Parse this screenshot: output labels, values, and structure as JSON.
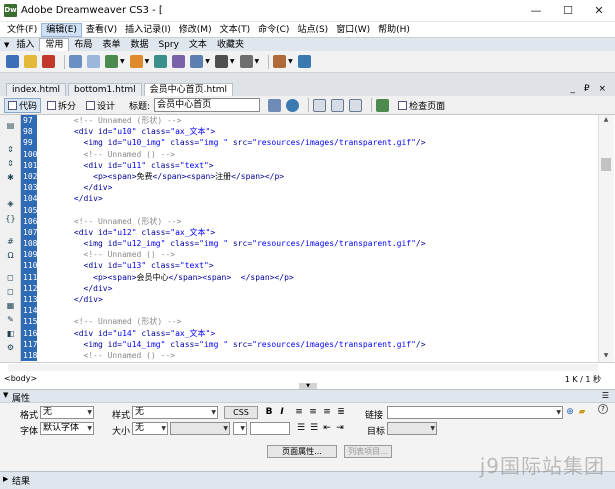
{
  "window": {
    "title": "Adobe Dreamweaver CS3 - [",
    "minimize": "—",
    "maximize": "☐",
    "close": "✕"
  },
  "menubar": [
    "文件(F)",
    "编辑(E)",
    "查看(V)",
    "插入记录(I)",
    "修改(M)",
    "文本(T)",
    "命令(C)",
    "站点(S)",
    "窗口(W)",
    "帮助(H)"
  ],
  "insertbar": {
    "label": "插入",
    "tabs": [
      "常用",
      "布局",
      "表单",
      "数据",
      "Spry",
      "文本",
      "收藏夹"
    ]
  },
  "document_tabs": [
    "index.html",
    "bottom1.html",
    "会员中心首页.html"
  ],
  "doc_controls": "_ ₽ ×",
  "doc_toolbar": {
    "code": "代码",
    "split": "拆分",
    "design": "设计",
    "title_label": "标题:",
    "title_value": "会员中心首页",
    "check_page": "检查页面"
  },
  "code_lines": [
    {
      "n": "97",
      "segs": [
        {
          "c": "cmt",
          "t": "      <!-- Unnamed (形状) -->"
        }
      ]
    },
    {
      "n": "98",
      "segs": [
        {
          "c": "tag",
          "t": "      <div id="
        },
        {
          "c": "val",
          "t": "\"u10\""
        },
        {
          "c": "tag",
          "t": " class="
        },
        {
          "c": "val",
          "t": "\"ax_文本\""
        },
        {
          "c": "tag",
          "t": ">"
        }
      ]
    },
    {
      "n": "99",
      "segs": [
        {
          "c": "tag",
          "t": "        <img id="
        },
        {
          "c": "val",
          "t": "\"u10_img\""
        },
        {
          "c": "tag",
          "t": " class="
        },
        {
          "c": "val",
          "t": "\"img \""
        },
        {
          "c": "tag",
          "t": " src="
        },
        {
          "c": "val",
          "t": "\"resources/images/transparent.gif\""
        },
        {
          "c": "tag",
          "t": "/>"
        }
      ]
    },
    {
      "n": "100",
      "segs": [
        {
          "c": "cmt",
          "t": "        <!-- Unnamed () -->"
        }
      ]
    },
    {
      "n": "101",
      "segs": [
        {
          "c": "tag",
          "t": "        <div id="
        },
        {
          "c": "val",
          "t": "\"u11\""
        },
        {
          "c": "tag",
          "t": " class="
        },
        {
          "c": "val",
          "t": "\"text\""
        },
        {
          "c": "tag",
          "t": ">"
        }
      ]
    },
    {
      "n": "102",
      "segs": [
        {
          "c": "tag",
          "t": "          <p><span>"
        },
        {
          "c": "txt",
          "t": "免费"
        },
        {
          "c": "tag",
          "t": "</span><span>"
        },
        {
          "c": "txt",
          "t": "注册"
        },
        {
          "c": "tag",
          "t": "</span></p>"
        }
      ]
    },
    {
      "n": "103",
      "segs": [
        {
          "c": "tag",
          "t": "        </div>"
        }
      ]
    },
    {
      "n": "104",
      "segs": [
        {
          "c": "tag",
          "t": "      </div>"
        }
      ]
    },
    {
      "n": "105",
      "segs": [
        {
          "c": "txt",
          "t": ""
        }
      ]
    },
    {
      "n": "106",
      "segs": [
        {
          "c": "cmt",
          "t": "      <!-- Unnamed (形状) -->"
        }
      ]
    },
    {
      "n": "107",
      "segs": [
        {
          "c": "tag",
          "t": "      <div id="
        },
        {
          "c": "val",
          "t": "\"u12\""
        },
        {
          "c": "tag",
          "t": " class="
        },
        {
          "c": "val",
          "t": "\"ax_文本\""
        },
        {
          "c": "tag",
          "t": ">"
        }
      ]
    },
    {
      "n": "108",
      "segs": [
        {
          "c": "tag",
          "t": "        <img id="
        },
        {
          "c": "val",
          "t": "\"u12_img\""
        },
        {
          "c": "tag",
          "t": " class="
        },
        {
          "c": "val",
          "t": "\"img \""
        },
        {
          "c": "tag",
          "t": " src="
        },
        {
          "c": "val",
          "t": "\"resources/images/transparent.gif\""
        },
        {
          "c": "tag",
          "t": "/>"
        }
      ]
    },
    {
      "n": "109",
      "segs": [
        {
          "c": "cmt",
          "t": "        <!-- Unnamed () -->"
        }
      ]
    },
    {
      "n": "110",
      "segs": [
        {
          "c": "tag",
          "t": "        <div id="
        },
        {
          "c": "val",
          "t": "\"u13\""
        },
        {
          "c": "tag",
          "t": " class="
        },
        {
          "c": "val",
          "t": "\"text\""
        },
        {
          "c": "tag",
          "t": ">"
        }
      ]
    },
    {
      "n": "111",
      "segs": [
        {
          "c": "tag",
          "t": "          <p><span>"
        },
        {
          "c": "txt",
          "t": "会员中心"
        },
        {
          "c": "tag",
          "t": "</span><span>  </span></p>"
        }
      ]
    },
    {
      "n": "112",
      "segs": [
        {
          "c": "tag",
          "t": "        </div>"
        }
      ]
    },
    {
      "n": "113",
      "segs": [
        {
          "c": "tag",
          "t": "      </div>"
        }
      ]
    },
    {
      "n": "114",
      "segs": [
        {
          "c": "txt",
          "t": ""
        }
      ]
    },
    {
      "n": "115",
      "segs": [
        {
          "c": "cmt",
          "t": "      <!-- Unnamed (形状) -->"
        }
      ]
    },
    {
      "n": "116",
      "segs": [
        {
          "c": "tag",
          "t": "      <div id="
        },
        {
          "c": "val",
          "t": "\"u14\""
        },
        {
          "c": "tag",
          "t": " class="
        },
        {
          "c": "val",
          "t": "\"ax_文本\""
        },
        {
          "c": "tag",
          "t": ">"
        }
      ]
    },
    {
      "n": "117",
      "segs": [
        {
          "c": "tag",
          "t": "        <img id="
        },
        {
          "c": "val",
          "t": "\"u14_img\""
        },
        {
          "c": "tag",
          "t": " class="
        },
        {
          "c": "val",
          "t": "\"img \""
        },
        {
          "c": "tag",
          "t": " src="
        },
        {
          "c": "val",
          "t": "\"resources/images/transparent.gif\""
        },
        {
          "c": "tag",
          "t": "/>"
        }
      ]
    },
    {
      "n": "118",
      "segs": [
        {
          "c": "cmt",
          "t": "        <!-- Unnamed () -->"
        }
      ]
    }
  ],
  "status": {
    "tag": "<body>",
    "right": "1 K / 1 秒"
  },
  "properties": {
    "title": "属性",
    "format_label": "格式",
    "format_value": "无",
    "style_label": "样式",
    "style_value": "无",
    "css_button": "CSS",
    "link_label": "链接",
    "font_label": "字体",
    "font_value": "默认字体",
    "size_label": "大小",
    "size_value": "无",
    "target_label": "目标",
    "page_props_button": "页面属性...",
    "list_item_button": "列表项目..."
  },
  "results": {
    "title": "结果"
  },
  "watermark": "j9国际站集团",
  "colors": {
    "line_number_bg": "#2f6ab5",
    "tag_color": "#000099",
    "value_color": "#0000ff",
    "comment_color": "#8a8a8a"
  }
}
